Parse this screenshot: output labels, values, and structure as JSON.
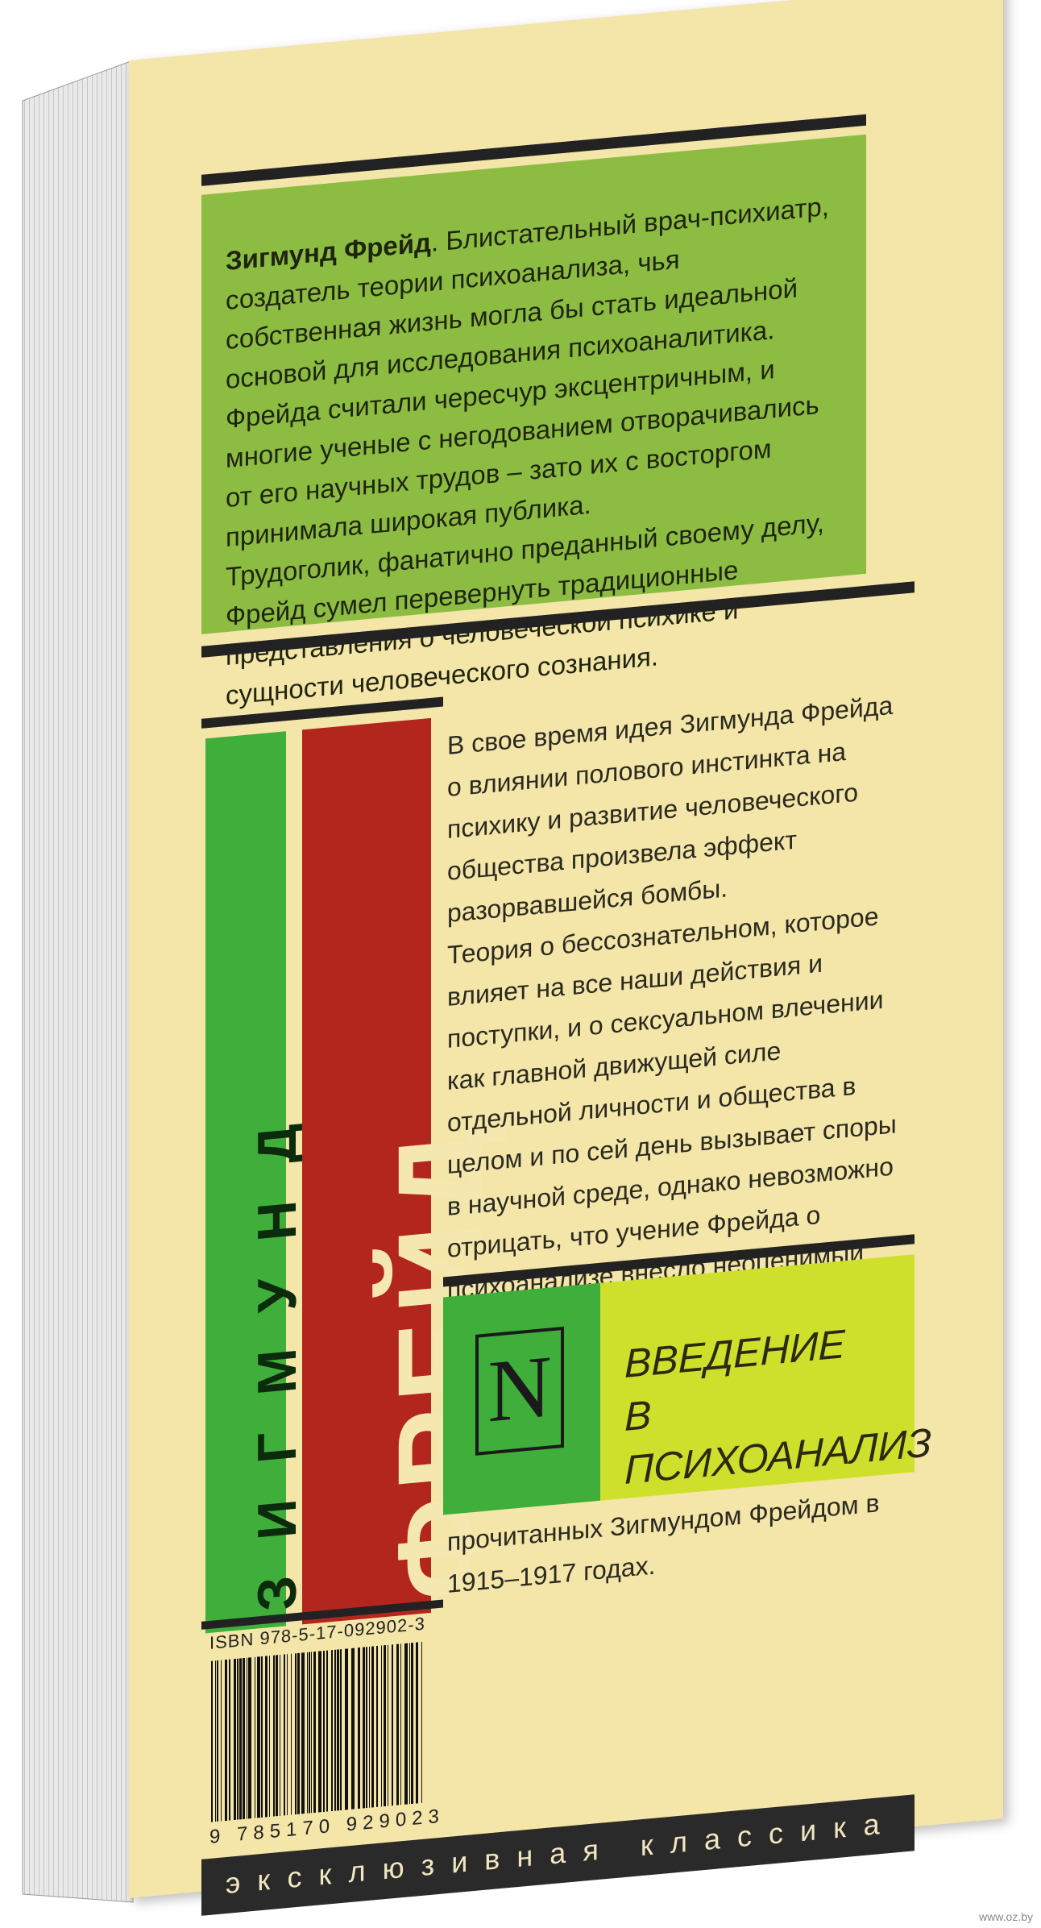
{
  "author_bio": {
    "name": "Зигмунд Фрейд",
    "text": ". Блистательный врач-психиатр, создатель теории психоанализа, чья собственная жизнь могла бы стать идеальной основой для исследования психоаналитика. Фрейда считали чересчур эксцентричным, и многие ученые с негодованием отворачивались от его научных трудов – зато их с восторгом принимала широкая публика.",
    "text2": "Трудоголик, фанатично преданный своему делу, Фрейд сумел перевернуть традиционные представления о человеческой психике и сущности человеческого сознания."
  },
  "spine": {
    "first_name": "ЗИГМУНД",
    "last_name": "ФРЕЙД"
  },
  "description": [
    "В свое время идея Зигмунда Фрейда о влиянии полового инстинкта на психику и развитие человеческого общества произвела эффект разорвавшейся бомбы.",
    "Теория о бессознательном, которое влияет на все наши действия и поступки, и о сексуальном влечении как главной движущей силе отдельной личности и общества в целом и по сей день вызывает споры в научной среде, однако невозможно отрицать, что учение Фрейда о психоанализе внесло неоценимый вклад в развитие всей мировой психологии.",
    "Предлагаемое вниманию читателя издание представляет собой цикл лекций по введению в психоанализ, прочитанных Зигмундом Фрейдом в 1915–1917 годах."
  ],
  "title": {
    "line1": "ВВЕДЕНИЕ",
    "line2": "В ПСИХОАНАЛИЗ"
  },
  "logo_letter": "N",
  "isbn": "ISBN 978-5-17-092902-3",
  "barcode_digits": "9 785170 929023",
  "series": "эксклюзивная классика",
  "watermark": "www.oz.by",
  "colors": {
    "cover": "#f4e5a8",
    "green_panel": "#8cbd42",
    "bright_green": "#3fae3a",
    "red": "#b3261e",
    "yellow_green": "#cfe02c"
  }
}
